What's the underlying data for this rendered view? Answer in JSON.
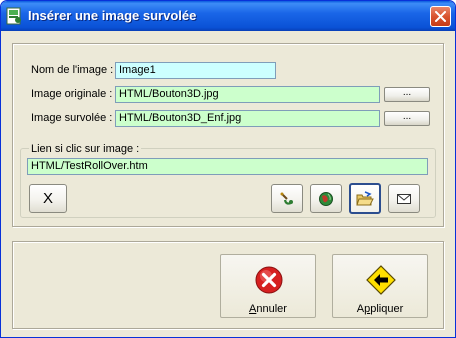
{
  "window": {
    "title": "Insérer une image survolée",
    "accent": "#0a52d6",
    "background": "#ece9d8"
  },
  "form": {
    "nom_label": "Nom de l'image :",
    "nom_value": "Image1",
    "originale_label": "Image originale :",
    "originale_value": "HTML/Bouton3D.jpg",
    "survolee_label": "Image survolée :",
    "survolee_value": "HTML/Bouton3D_Enf.jpg",
    "browse_label": "...",
    "lien_label": "Lien si clic sur image :",
    "lien_value": "HTML/TestRollOver.htm",
    "field_colors": {
      "cyan": "#ccffff",
      "green": "#ccffcc"
    }
  },
  "toolbar": {
    "clear_label": "X",
    "icons": [
      "link-anchor-icon",
      "globe-icon",
      "open-folder-icon",
      "mail-icon"
    ]
  },
  "actions": {
    "annuler_label": "Annuler",
    "annuler_accel": "A",
    "annuler_rest": "nnuler",
    "appliquer_label": "Appliquer",
    "appliquer_accel": "p",
    "appliquer_pre": "A",
    "appliquer_rest": "pliquer"
  }
}
